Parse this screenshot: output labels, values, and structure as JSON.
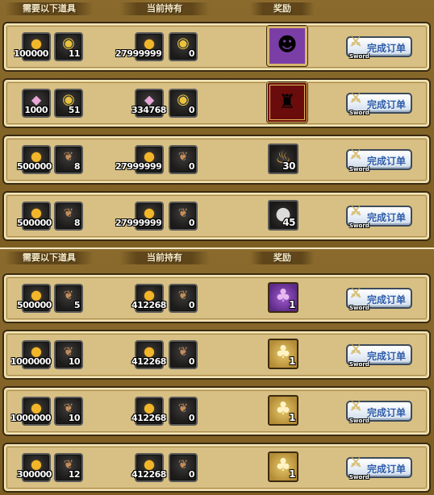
{
  "headers": {
    "need": "需要以下道具",
    "have": "当前持有",
    "reward": "奖励"
  },
  "button": {
    "label": "完成订单",
    "tag": "Sword"
  },
  "colors": {
    "panel_bg": "#8b6b2d",
    "row_bg": "#d8c084",
    "button_text": "#2b5ba8"
  },
  "orders": [
    {
      "req1": {
        "icon": "gold-coin-icon",
        "qty": "100000"
      },
      "req2": {
        "icon": "gold-medal-icon",
        "qty": "11"
      },
      "have1": {
        "icon": "gold-coin-icon",
        "qty": "27999999"
      },
      "have2": {
        "icon": "gold-medal-icon",
        "qty": "0"
      },
      "reward": {
        "icon": "masked-warrior-portrait-icon",
        "qty": ""
      }
    },
    {
      "req1": {
        "icon": "pink-gem-icon",
        "qty": "1000"
      },
      "req2": {
        "icon": "gold-medal-icon",
        "qty": "51"
      },
      "have1": {
        "icon": "pink-gem-icon",
        "qty": "334768"
      },
      "have2": {
        "icon": "gold-medal-icon",
        "qty": "0"
      },
      "reward": {
        "icon": "official-hat-character-portrait-icon",
        "qty": ""
      }
    },
    {
      "req1": {
        "icon": "gold-coin-icon",
        "qty": "500000"
      },
      "req2": {
        "icon": "wing-emblem-icon",
        "qty": "8"
      },
      "have1": {
        "icon": "gold-coin-icon",
        "qty": "27999999"
      },
      "have2": {
        "icon": "wing-emblem-icon",
        "qty": "0"
      },
      "reward": {
        "icon": "money-bag-icon",
        "qty": "30"
      }
    },
    {
      "req1": {
        "icon": "gold-coin-icon",
        "qty": "500000"
      },
      "req2": {
        "icon": "wing-emblem-icon",
        "qty": "8"
      },
      "have1": {
        "icon": "gold-coin-icon",
        "qty": "27999999"
      },
      "have2": {
        "icon": "wing-emblem-icon",
        "qty": "0"
      },
      "reward": {
        "icon": "bomb-icon",
        "qty": "45"
      }
    },
    {
      "req1": {
        "icon": "gold-coin-icon",
        "qty": "500000"
      },
      "req2": {
        "icon": "wing-emblem-icon",
        "qty": "5"
      },
      "have1": {
        "icon": "gold-coin-icon",
        "qty": "412268"
      },
      "have2": {
        "icon": "wing-emblem-icon",
        "qty": "0"
      },
      "reward": {
        "icon": "purple-pouch-icon",
        "qty": "1"
      }
    },
    {
      "req1": {
        "icon": "gold-coin-icon",
        "qty": "1000000"
      },
      "req2": {
        "icon": "wing-emblem-icon",
        "qty": "10"
      },
      "have1": {
        "icon": "gold-coin-icon",
        "qty": "412268"
      },
      "have2": {
        "icon": "wing-emblem-icon",
        "qty": "0"
      },
      "reward": {
        "icon": "gold-pouch-icon",
        "qty": "1"
      }
    },
    {
      "req1": {
        "icon": "gold-coin-icon",
        "qty": "1000000"
      },
      "req2": {
        "icon": "wing-emblem-icon",
        "qty": "10"
      },
      "have1": {
        "icon": "gold-coin-icon",
        "qty": "412268"
      },
      "have2": {
        "icon": "wing-emblem-icon",
        "qty": "0"
      },
      "reward": {
        "icon": "gold-pouch-icon",
        "qty": "1"
      }
    },
    {
      "req1": {
        "icon": "gold-coin-icon",
        "qty": "300000"
      },
      "req2": {
        "icon": "wing-emblem-icon",
        "qty": "12"
      },
      "have1": {
        "icon": "gold-coin-icon",
        "qty": "412268"
      },
      "have2": {
        "icon": "wing-emblem-icon",
        "qty": "0"
      },
      "reward": {
        "icon": "gold-pouch-icon",
        "qty": "1"
      }
    }
  ]
}
